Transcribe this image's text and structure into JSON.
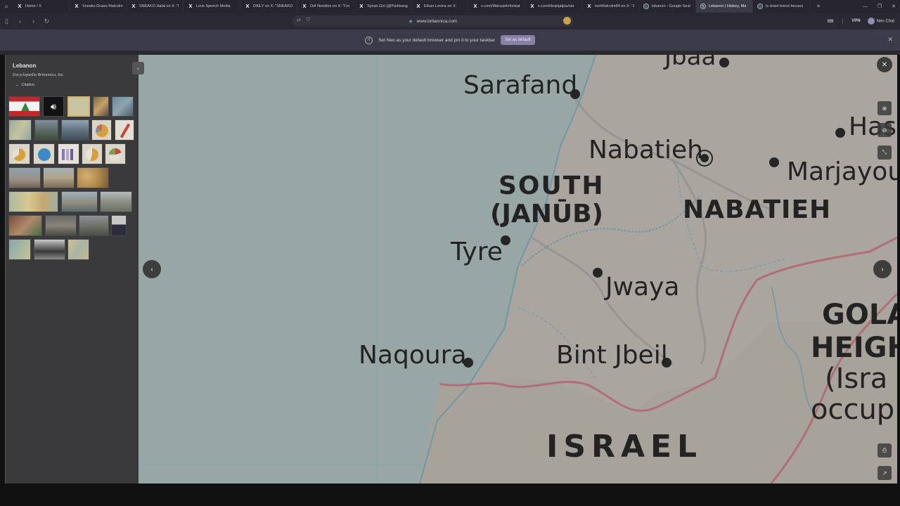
{
  "tabs": [
    {
      "label": "Home / X",
      "icon": "x-icon"
    },
    {
      "label": "Sneako Draws Malcolm",
      "icon": "x-icon"
    },
    {
      "label": "SNEAKO Halal on X: \"I",
      "icon": "x-icon"
    },
    {
      "label": "Love Speech Media",
      "icon": "x-icon"
    },
    {
      "label": "DAILY on X: \"SNEAKO",
      "icon": "x-icon"
    },
    {
      "label": "Def Noodles on X: \"For",
      "icon": "x-icon"
    },
    {
      "label": "Syrian Girl (@Partisang",
      "icon": "x-icon"
    },
    {
      "label": "Ethan Levins on X:",
      "icon": "x-icon"
    },
    {
      "label": "x.com/WarsawInfo/stat",
      "icon": "x-icon"
    },
    {
      "label": "x.com/Heqiqatjou/sta",
      "icon": "x-icon"
    },
    {
      "label": "IamMalcolm84 on X: \"J",
      "icon": "x-icon"
    },
    {
      "label": "lebanon - Google Sear",
      "icon": "google-icon"
    },
    {
      "label": "Lebanon | History, Ma",
      "icon": "britannica-icon"
    },
    {
      "label": "is israel beirut becaus",
      "icon": "google-icon"
    }
  ],
  "url": "www.britannica.com",
  "toolbar_right": {
    "vpn": "VPN",
    "profile": "Neo Chat"
  },
  "notification": {
    "text": "Set Neo as your default browser and pin it to your taskbar",
    "button": "Set as default"
  },
  "sidebar": {
    "title": "Lebanon",
    "subtitle": "Encyclopædia Britannica, Inc.",
    "citation": "Citation"
  },
  "map": {
    "labels": {
      "sarafand": "Sarafand",
      "jbaa": "Jbaa",
      "nabatieh_city": "Nabatieh",
      "has": "Has",
      "marjayoun": "Marjayou",
      "south_1": "SOUTH",
      "south_2": "(JANŪB)",
      "nabatieh_region": "NABATIEH",
      "tyre": "Tyre",
      "jwaya": "Jwaya",
      "naqoura": "Naqoura",
      "bint_jbeil": "Bint Jbeil",
      "israel": "ISRAEL",
      "golan_1": "GOLA",
      "golan_2": "HEIGH",
      "golan_3": "(Isra",
      "golan_4": "occup"
    }
  },
  "colors": {
    "sea": "#98a7a6",
    "land": "#aaa59f",
    "israel_land": "#a9a49c",
    "border": "#b06f76",
    "sidebar_bg": "#3a3a3c"
  }
}
